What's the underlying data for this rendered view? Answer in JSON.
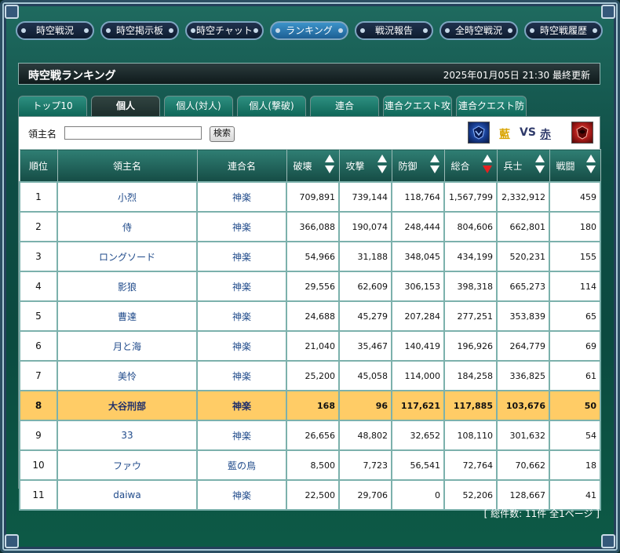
{
  "nav": [
    {
      "label": "時空戦況"
    },
    {
      "label": "時空掲示板"
    },
    {
      "label": "時空チャット"
    },
    {
      "label": "ランキング",
      "active": true
    },
    {
      "label": "戦況報告"
    },
    {
      "label": "全時空戦況"
    },
    {
      "label": "時空戦履歴"
    }
  ],
  "title": {
    "text": "時空戦ランキング",
    "updated": "2025年01月05日 21:30 最終更新"
  },
  "tabs": [
    {
      "label": "トップ10"
    },
    {
      "label": "個人",
      "active": true
    },
    {
      "label": "個人(対人)"
    },
    {
      "label": "個人(撃破)"
    },
    {
      "label": "連合"
    },
    {
      "label": "連合クエスト攻"
    },
    {
      "label": "連合クエスト防"
    }
  ],
  "search": {
    "label": "領主名",
    "value": "",
    "button": "検索"
  },
  "versus": {
    "blue": "藍",
    "vs": "VS",
    "red": "赤",
    "blue_color": "#d9a400"
  },
  "table": {
    "headers": {
      "rank": "順位",
      "lord": "領主名",
      "guild": "連合名",
      "destroy": "破壊",
      "attack": "攻撃",
      "defense": "防御",
      "total": "総合",
      "soldiers": "兵士",
      "battle": "戦闘"
    },
    "rows": [
      {
        "rank": "1",
        "lord": "小烈",
        "guild": "神楽",
        "destroy": "709,891",
        "attack": "739,144",
        "defense": "118,764",
        "total": "1,567,799",
        "soldiers": "2,332,912",
        "battle": "459"
      },
      {
        "rank": "2",
        "lord": "侍",
        "guild": "神楽",
        "destroy": "366,088",
        "attack": "190,074",
        "defense": "248,444",
        "total": "804,606",
        "soldiers": "662,801",
        "battle": "180"
      },
      {
        "rank": "3",
        "lord": "ロングソード",
        "guild": "神楽",
        "destroy": "54,966",
        "attack": "31,188",
        "defense": "348,045",
        "total": "434,199",
        "soldiers": "520,231",
        "battle": "155"
      },
      {
        "rank": "4",
        "lord": "影狼",
        "guild": "神楽",
        "destroy": "29,556",
        "attack": "62,609",
        "defense": "306,153",
        "total": "398,318",
        "soldiers": "665,273",
        "battle": "114"
      },
      {
        "rank": "5",
        "lord": "曹達",
        "guild": "神楽",
        "destroy": "24,688",
        "attack": "45,279",
        "defense": "207,284",
        "total": "277,251",
        "soldiers": "353,839",
        "battle": "65"
      },
      {
        "rank": "6",
        "lord": "月と海",
        "guild": "神楽",
        "destroy": "21,040",
        "attack": "35,467",
        "defense": "140,419",
        "total": "196,926",
        "soldiers": "264,779",
        "battle": "69"
      },
      {
        "rank": "7",
        "lord": "美怜",
        "guild": "神楽",
        "destroy": "25,200",
        "attack": "45,058",
        "defense": "114,000",
        "total": "184,258",
        "soldiers": "336,825",
        "battle": "61"
      },
      {
        "rank": "8",
        "lord": "大谷刑部",
        "guild": "神楽",
        "destroy": "168",
        "attack": "96",
        "defense": "117,621",
        "total": "117,885",
        "soldiers": "103,676",
        "battle": "50",
        "highlight": true
      },
      {
        "rank": "9",
        "lord": "33",
        "guild": "神楽",
        "destroy": "26,656",
        "attack": "48,802",
        "defense": "32,652",
        "total": "108,110",
        "soldiers": "301,632",
        "battle": "54"
      },
      {
        "rank": "10",
        "lord": "ファウ",
        "guild": "藍の鳥",
        "destroy": "8,500",
        "attack": "7,723",
        "defense": "56,541",
        "total": "72,764",
        "soldiers": "70,662",
        "battle": "18"
      },
      {
        "rank": "11",
        "lord": "daiwa",
        "guild": "神楽",
        "destroy": "22,500",
        "attack": "29,706",
        "defense": "0",
        "total": "52,206",
        "soldiers": "128,667",
        "battle": "41"
      }
    ]
  },
  "footer": "[ 総件数: 11件  全1ページ ]",
  "colors": {
    "highlight_row": "#ffcc66",
    "active_sort_arrow": "#e62020",
    "header_bg": "#2f7e73"
  }
}
